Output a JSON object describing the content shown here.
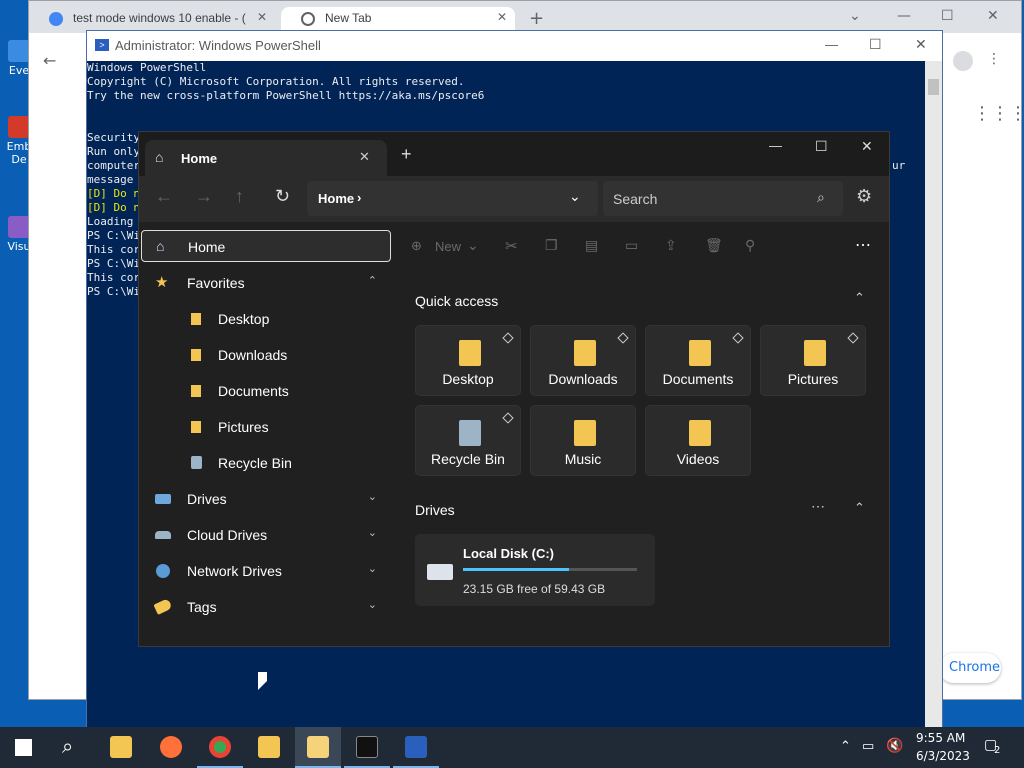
{
  "desktop": {
    "icons": [
      "Eve",
      "Emb",
      "De",
      "Visu"
    ]
  },
  "chrome": {
    "tabs": [
      {
        "title": "test mode windows 10 enable - ("
      },
      {
        "title": "New Tab"
      }
    ],
    "new_tab": "+",
    "promo_text": "Chrome"
  },
  "powershell": {
    "title": "Administrator: Windows PowerShell",
    "lines": [
      "Windows PowerShell",
      "Copyright (C) Microsoft Corporation. All rights reserved.",
      "",
      "Try the new cross-platform PowerShell https://aka.ms/pscore6",
      "",
      "",
      "Security",
      "Run only",
      "computer",
      "message",
      "[D] Do n",
      "[D] Do n",
      "Loading",
      "PS C:\\Wi",
      "This cor",
      "PS C:\\Wi",
      "This cor",
      "PS C:\\Wi"
    ],
    "right_fragment": "ur"
  },
  "explorer": {
    "tab_title": "Home",
    "address": "Home",
    "search_placeholder": "Search",
    "new_label": "New",
    "sidebar": [
      {
        "label": "Home",
        "icon": "home-icon",
        "selected": true
      },
      {
        "label": "Favorites",
        "icon": "star-icon",
        "chevron": "^"
      },
      {
        "label": "Desktop",
        "icon": "folder-icon",
        "indent": true
      },
      {
        "label": "Downloads",
        "icon": "folder-icon",
        "indent": true
      },
      {
        "label": "Documents",
        "icon": "folder-icon",
        "indent": true
      },
      {
        "label": "Pictures",
        "icon": "folder-icon",
        "indent": true
      },
      {
        "label": "Recycle Bin",
        "icon": "recycle-bin-icon",
        "indent": true
      },
      {
        "label": "Drives",
        "icon": "drive-icon",
        "chevron": "v"
      },
      {
        "label": "Cloud Drives",
        "icon": "cloud-icon",
        "chevron": "v"
      },
      {
        "label": "Network Drives",
        "icon": "network-icon",
        "chevron": "v"
      },
      {
        "label": "Tags",
        "icon": "tag-icon",
        "chevron": "v"
      }
    ],
    "quick_access_title": "Quick access",
    "quick_access": [
      "Desktop",
      "Downloads",
      "Documents",
      "Pictures",
      "Recycle Bin",
      "Music",
      "Videos"
    ],
    "drives_title": "Drives",
    "drive": {
      "name": "Local Disk (C:)",
      "free_text": "23.15 GB free of 59.43 GB",
      "used_fraction": 0.61
    }
  },
  "taskbar": {
    "time": "9:55 AM",
    "date": "6/3/2023",
    "notification_count": "2",
    "apps": [
      "start-icon",
      "search-icon",
      "file-explorer-icon",
      "firefox-icon",
      "chrome-icon",
      "files-icon",
      "files-app-icon",
      "terminal-icon",
      "powershell-icon"
    ]
  },
  "colors": {
    "desktop": "#0a5fb4",
    "powershell_bg": "#012456",
    "explorer_bg": "#202020",
    "accent": "#4cc2ff"
  }
}
